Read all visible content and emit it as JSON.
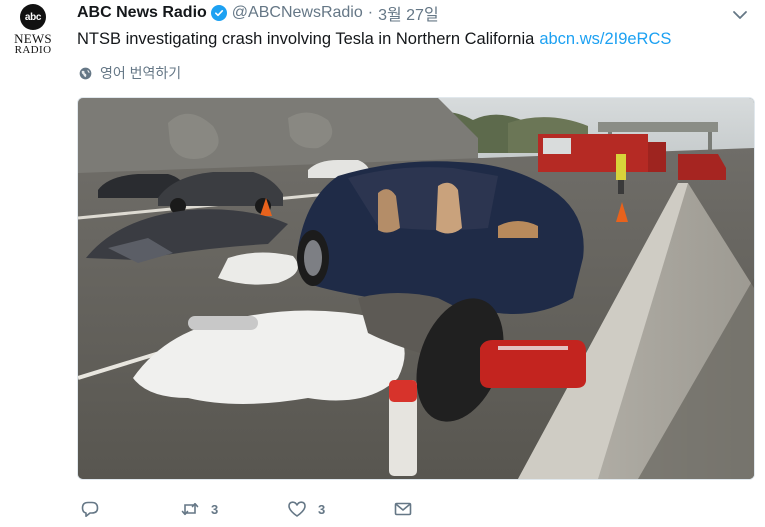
{
  "account": {
    "avatar_top": "abc",
    "avatar_line1": "NEWS",
    "avatar_line2": "RADIO",
    "display_name": "ABC News Radio",
    "handle": "@ABCNewsRadio",
    "separator": "·",
    "timestamp": "3월 27일",
    "verified": true
  },
  "tweet": {
    "text": "NTSB investigating crash involving Tesla in Northern California",
    "link": "abcn.ws/2I9eRCS"
  },
  "translate": {
    "label": "영어 번역하기",
    "icon": "globe-icon"
  },
  "media": {
    "kind": "photo",
    "subject": "wrecked Tesla on highway barrier"
  },
  "actions": {
    "reply": {
      "icon": "reply-icon",
      "count": ""
    },
    "retweet": {
      "icon": "retweet-icon",
      "count": "3"
    },
    "like": {
      "icon": "heart-icon",
      "count": "3"
    },
    "dm": {
      "icon": "envelope-icon",
      "count": ""
    }
  },
  "colors": {
    "link": "#1da1f2",
    "verified": "#1da1f2",
    "secondary_text": "#657786"
  }
}
